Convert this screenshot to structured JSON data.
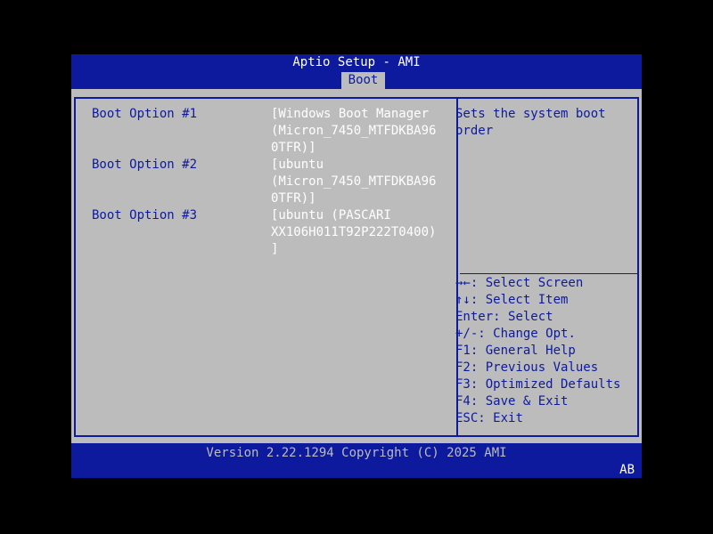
{
  "header": {
    "title": "Aptio Setup - AMI",
    "active_tab": "Boot"
  },
  "colors": {
    "background": "#000000",
    "panel_blue": "#0d1a9e",
    "panel_gray": "#bcbcbc",
    "text_white": "#ffffff"
  },
  "boot_options": [
    {
      "label": "Boot Option #1",
      "value_lines": [
        "[Windows Boot Manager",
        "(Micron_7450_MTFDKBA96",
        "0TFR)]"
      ]
    },
    {
      "label": "Boot Option #2",
      "value_lines": [
        "[ubuntu",
        "(Micron_7450_MTFDKBA96",
        "0TFR)]"
      ]
    },
    {
      "label": "Boot Option #3",
      "value_lines": [
        "[ubuntu (PASCARI",
        "XX106H011T92P222T0400)",
        "]"
      ]
    }
  ],
  "help": {
    "description_lines": [
      "Sets the system boot",
      "order"
    ],
    "keys": [
      {
        "key_icon": "left-right-arrows-icon",
        "key": "→←",
        "text": ": Select Screen"
      },
      {
        "key_icon": "up-down-arrows-icon",
        "key": "↑↓",
        "text": ": Select Item"
      },
      {
        "key": "Enter",
        "text": ": Select"
      },
      {
        "key": "+/-",
        "text": ": Change Opt."
      },
      {
        "key": "F1",
        "text": ": General Help"
      },
      {
        "key": "F2",
        "text": ": Previous Values"
      },
      {
        "key": "F3",
        "text": ": Optimized Defaults"
      },
      {
        "key": "F4",
        "text": ": Save & Exit"
      },
      {
        "key": "ESC",
        "text": ": Exit"
      }
    ]
  },
  "footer": {
    "version": "Version 2.22.1294 Copyright (C) 2025 AMI",
    "corner_code": "AB"
  }
}
